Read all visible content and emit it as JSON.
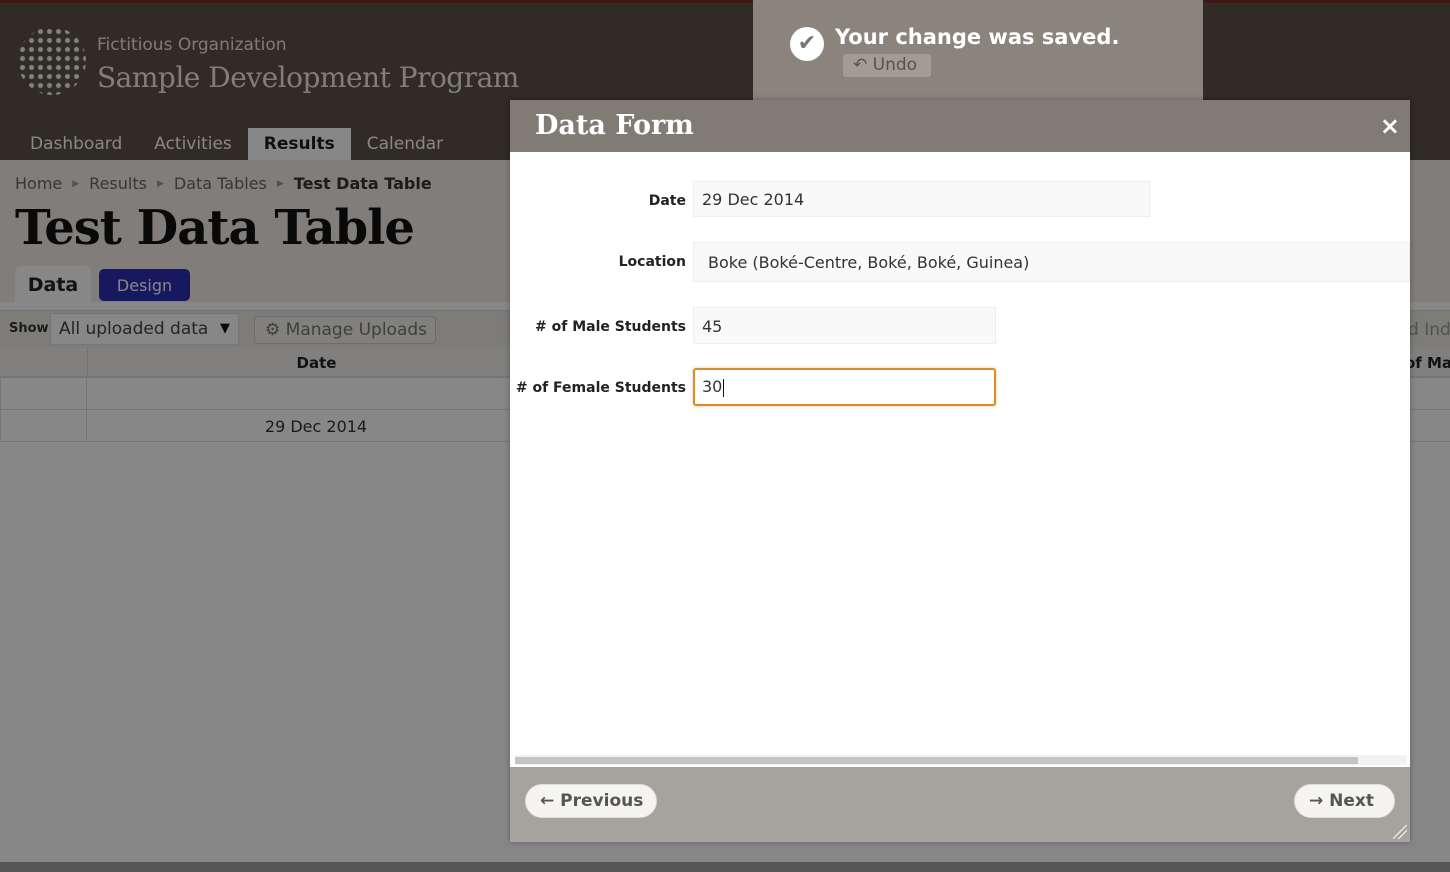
{
  "header": {
    "org_name": "Fictitious Organization",
    "program_name": "Sample Development Program",
    "nav": [
      "Dashboard",
      "Activities",
      "Results",
      "Calendar"
    ],
    "active_nav": "Results"
  },
  "breadcrumb": [
    "Home",
    "Results",
    "Data Tables",
    "Test Data Table"
  ],
  "page_title": "Test Data Table",
  "tabs": {
    "data": "Data",
    "design": "Design"
  },
  "toolbar": {
    "show_label": "Show",
    "show_value": "All uploaded data",
    "manage_uploads": "Manage Uploads",
    "right_partial": "d Ind"
  },
  "table": {
    "headers": {
      "date": "Date",
      "right_partial": "of Mal"
    },
    "rows": [
      {
        "date": ""
      },
      {
        "date": "29 Dec 2014"
      }
    ]
  },
  "toast": {
    "message": "Your change was saved.",
    "undo_label": "Undo"
  },
  "dialog": {
    "title": "Data Form",
    "close_glyph": "×",
    "fields": {
      "date": {
        "label": "Date",
        "value": "29 Dec 2014"
      },
      "location": {
        "label": "Location",
        "value": "Boke (Boké-Centre, Boké, Boké, Guinea)"
      },
      "male": {
        "label": "# of Male Students",
        "value": "45"
      },
      "female": {
        "label": "# of Female Students",
        "value": "30"
      }
    },
    "prev_label": "Previous",
    "next_label": "Next"
  },
  "colors": {
    "header_bg": "#5c5247",
    "design_tab": "#2d2fb3",
    "focus_border": "#d98c2a"
  }
}
